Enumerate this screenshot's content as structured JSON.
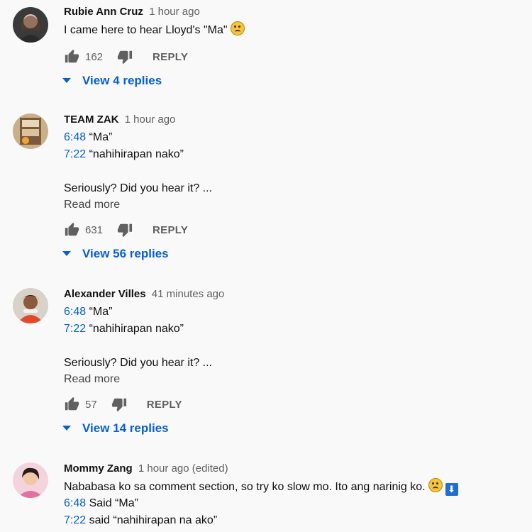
{
  "comments": [
    {
      "author": "Rubie Ann Cruz",
      "time": "1 hour ago",
      "lines": [
        {
          "text": "I came here to hear Lloyd's \"Ma\""
        }
      ],
      "likes": "162",
      "reply_label": "REPLY",
      "replies_label": "View 4 replies"
    },
    {
      "author": "TEAM ZAK",
      "time": "1 hour ago",
      "lines": [
        {
          "ts": "6:48",
          "text": " “Ma”"
        },
        {
          "ts": "7:22",
          "text": " “nahihirapan nako”"
        },
        {
          "blank": true
        },
        {
          "text": "Seriously? Did you hear it? ..."
        }
      ],
      "read_more": "Read more",
      "likes": "631",
      "reply_label": "REPLY",
      "replies_label": "View 56 replies"
    },
    {
      "author": "Alexander Villes",
      "time": "41 minutes ago",
      "lines": [
        {
          "ts": "6:48",
          "text": " “Ma”"
        },
        {
          "ts": "7:22",
          "text": " “nahihirapan nako”"
        },
        {
          "blank": true
        },
        {
          "text": "Seriously? Did you hear it? ..."
        }
      ],
      "read_more": "Read more",
      "likes": "57",
      "reply_label": "REPLY",
      "replies_label": "View 14 replies"
    },
    {
      "author": "Mommy Zang",
      "time": "1 hour ago (edited)",
      "lines": [
        {
          "text": "Nababasa ko sa comment section, so try ko slow mo. Ito ang narinig ko."
        },
        {
          "ts": "6:48",
          "text": " Said “Ma”"
        },
        {
          "ts": "7:22",
          "text": " said “nahihirapan na ako”"
        }
      ]
    }
  ],
  "colors": {
    "link": "#065fd4",
    "meta": "#606060",
    "background": "#f9f9f9"
  },
  "icons": {
    "like": "thumb-up-icon",
    "dislike": "thumb-down-icon",
    "expand": "caret-down-icon",
    "emoji": "confused-face-emoji",
    "arrow": "down-arrow-emoji"
  }
}
